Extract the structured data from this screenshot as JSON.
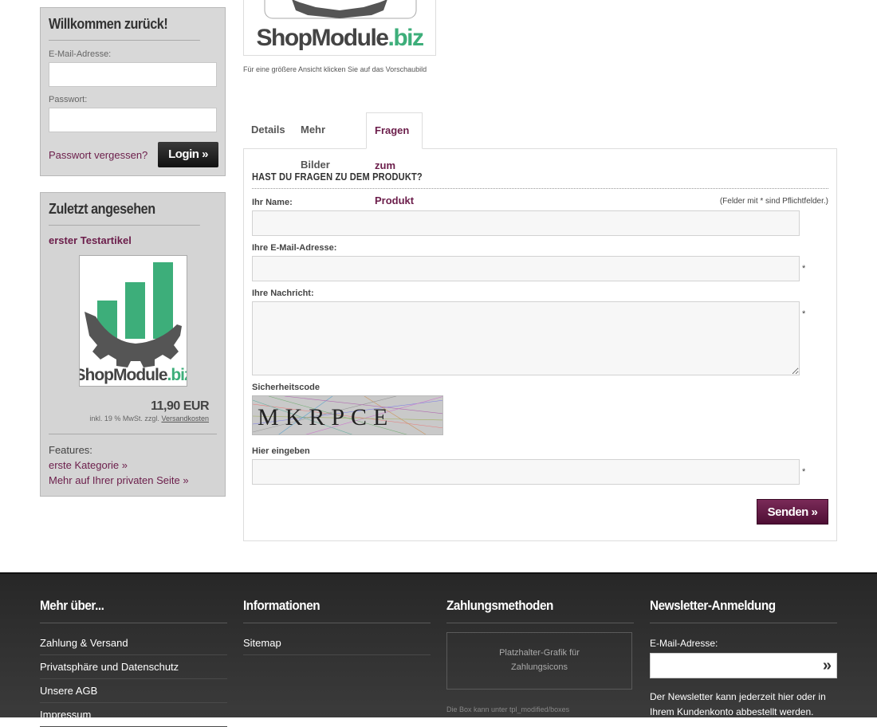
{
  "login": {
    "title": "Willkommen zurück!",
    "email_label": "E-Mail-Adresse:",
    "email_value": "",
    "password_label": "Passwort:",
    "password_value": "",
    "forgot_link": "Passwort vergessen?",
    "login_button": "Login »"
  },
  "recent": {
    "title": "Zuletzt angesehen",
    "article_name": "erster Testartikel",
    "price": "11,90 EUR",
    "tax_prefix": "inkl. 19 % MwSt. zzgl.",
    "tax_link": "Versandkosten",
    "features_label": "Features:",
    "link1": "erste Kategorie »",
    "link2": "Mehr auf Ihrer privaten Seite »"
  },
  "logo": {
    "brand_main": "ShopModule",
    "brand_tld": ".biz",
    "brand_color": "#3dae7a"
  },
  "product": {
    "image_caption": "Für eine größere Ansicht klicken Sie auf das Vorschaubild",
    "tabs": [
      "Details",
      "Mehr Bilder",
      "Fragen zum Produkt"
    ],
    "active_tab": 2
  },
  "question_form": {
    "heading": "HAST DU FRAGEN ZU DEM PRODUKT?",
    "required_note": "(Felder mit * sind Pflichtfelder.)",
    "name_label": "Ihr Name:",
    "email_label": "Ihre E-Mail-Adresse:",
    "message_label": "Ihre Nachricht:",
    "captcha_label": "Sicherheitscode",
    "captcha_text": "MKRPCE",
    "enter_label": "Hier eingeben",
    "required_mark": "*",
    "send_button": "Senden »"
  },
  "footer": {
    "col1": {
      "title": "Mehr über...",
      "links": [
        "Zahlung & Versand",
        "Privatsphäre und Datenschutz",
        "Unsere AGB",
        "Impressum"
      ]
    },
    "col2": {
      "title": "Informationen",
      "links": [
        "Sitemap"
      ]
    },
    "col3": {
      "title": "Zahlungsmethoden",
      "placeholder_line1": "Platzhalter-Grafik für",
      "placeholder_line2": "Zahlungsicons",
      "note": "Die Box kann unter tpl_modified/boxes"
    },
    "col4": {
      "title": "Newsletter-Anmeldung",
      "email_label": "E-Mail-Adresse:",
      "go_icon": "»",
      "text": "Der Newsletter kann jederzeit hier oder in Ihrem Kundenkonto abbestellt werden."
    }
  },
  "colors": {
    "accent": "#6b1d4a",
    "footer_bg": "#333333",
    "chart_green": "#3dae7a",
    "gear_gray": "#555555"
  }
}
